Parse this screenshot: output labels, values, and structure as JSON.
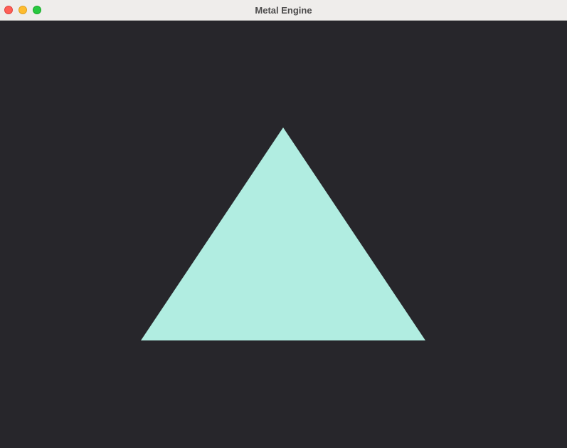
{
  "window": {
    "title": "Metal Engine",
    "controls": {
      "close_color": "#fe5f57",
      "minimize_color": "#febc2e",
      "zoom_color": "#28c840"
    }
  },
  "render": {
    "clear_color": "#27262b",
    "triangle_color": "#b1ede1"
  }
}
